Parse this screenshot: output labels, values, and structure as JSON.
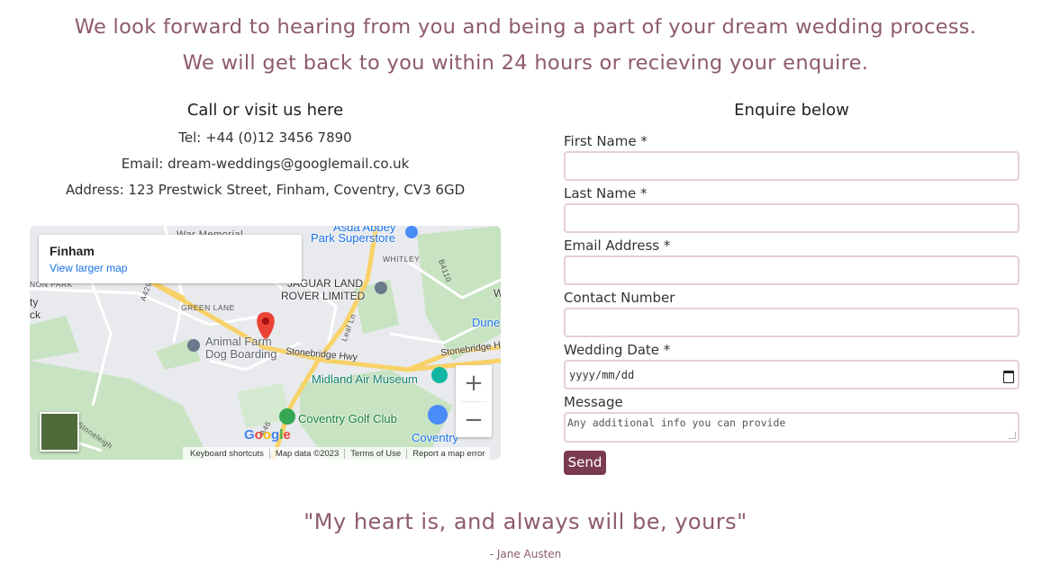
{
  "intro": {
    "line1": "We look forward to hearing from you and being a part of your dream wedding process.",
    "line2": "We will get back to you within 24 hours or recieving your enquire."
  },
  "contact": {
    "heading": "Call or visit us here",
    "tel": "Tel: +44 (0)12 3456 7890",
    "email": "Email: dream-weddings@googlemail.co.uk",
    "address": "Address: 123 Prestwick Street, Finham, Coventry, CV3 6GD"
  },
  "map": {
    "place_name": "Finham",
    "view_larger": "View larger map",
    "zoom_in": "+",
    "zoom_out": "−",
    "google_logo": "Google",
    "attribution": {
      "shortcuts": "Keyboard shortcuts",
      "data": "Map data ©2023",
      "terms": "Terms of Use",
      "report": "Report a map error"
    },
    "labels": {
      "war_memorial": "War Memorial",
      "asda": "Asda Abbey",
      "park_superstore": "Park Superstore",
      "whitley": "WHITLEY",
      "b4110": "B4110",
      "non_park": "NON PARK",
      "a429": "A429",
      "jaguar1": "JAGUAR LAND",
      "jaguar2": "ROVER LIMITED",
      "green_lane": "GREEN LANE",
      "ty": "ty",
      "ck": "ck",
      "animal_farm1": "Animal Farm",
      "animal_farm2": "Dog Boarding",
      "leaf_ln": "Leaf Ln",
      "dune": "Dune",
      "stonebridge_hwy": "Stonebridge Hwy",
      "stonebridge_h": "Stonebridge H",
      "midland": "Midland Air Museum",
      "coventry_golf": "Coventry Golf Club",
      "coventry": "Coventry",
      "a46": "A46",
      "stoneleigh": "Stoneleigh",
      "w": "W"
    },
    "colors": {
      "marker": "#ea4335",
      "road": "#f8d268",
      "park": "#c7e3c1"
    }
  },
  "form": {
    "heading": "Enquire below",
    "first_name_label": "First Name *",
    "last_name_label": "Last Name *",
    "email_label": "Email Address *",
    "contact_label": "Contact Number",
    "date_label": "Wedding Date *",
    "date_placeholder": "yyyy/mm/dd",
    "message_label": "Message",
    "message_placeholder": "Any additional info you can provide",
    "send_label": "Send"
  },
  "quote": {
    "text": "\"My heart is, and always will be, yours\"",
    "author": "- Jane Austen"
  },
  "theme": {
    "accent": "#8d5a6e",
    "button": "#7a3b52",
    "input_border": "#e6cfd7"
  }
}
